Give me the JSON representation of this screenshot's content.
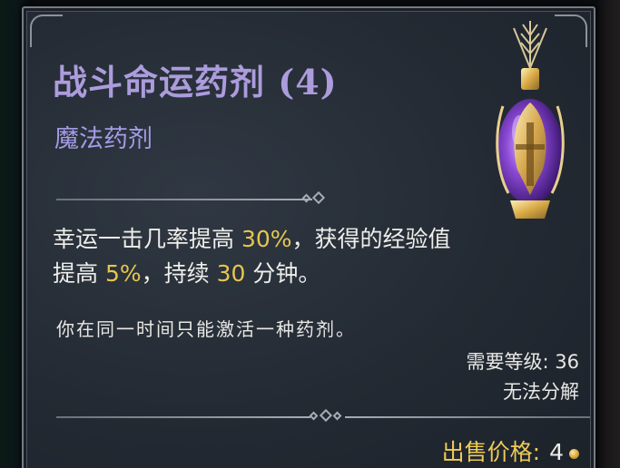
{
  "item": {
    "name": "战斗命运药剂 (4)",
    "type": "魔法药剂",
    "description": {
      "line1_a": "幸运一击几率提高 ",
      "line1_value": "30%",
      "line1_b": "，获得的经验值",
      "line2_a": "提高 ",
      "line2_value": "5%",
      "line2_b": "，持续 ",
      "line2_duration": "30",
      "line2_c": " 分钟。"
    },
    "note": "你在同一时间只能激活一种药剂。",
    "required_level": "需要等级: 36",
    "salvage": "无法分解",
    "sell_label": "出售价格:",
    "sell_price": "4",
    "icon": "purple-potion-with-golden-arrows",
    "currency_icon": "gold-coin-icon"
  },
  "colors": {
    "title": "#ac9cdc",
    "subtitle": "#a59be6",
    "highlight": "#e6c64f",
    "sell_label": "#eeca57",
    "panel": "#232a33"
  }
}
